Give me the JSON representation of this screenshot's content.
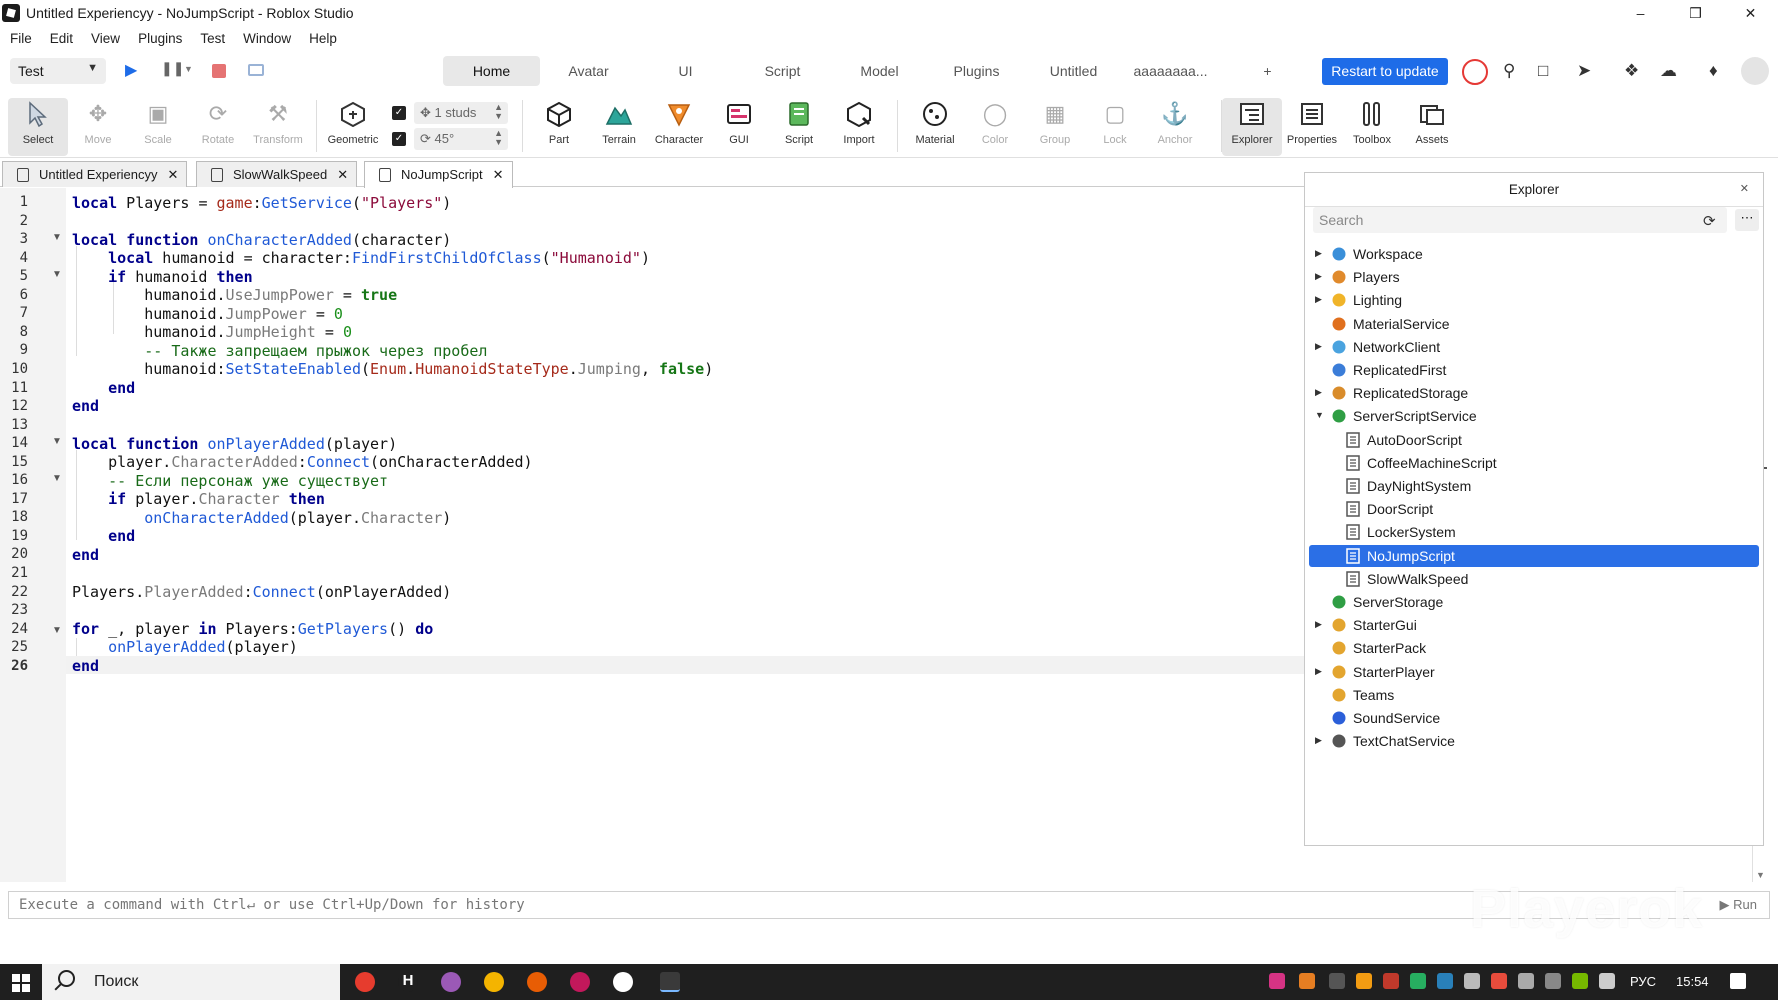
{
  "window": {
    "title": "Untitled Experiencyy - NoJumpScript - Roblox Studio",
    "controls": [
      "–",
      "❒",
      "✕"
    ]
  },
  "menu": [
    "File",
    "Edit",
    "View",
    "Plugins",
    "Test",
    "Window",
    "Help"
  ],
  "topnav": {
    "test_select": "Test",
    "tabs": [
      "Home",
      "Avatar",
      "UI",
      "Script",
      "Model",
      "Plugins",
      "Untitled",
      "aaaaaaaa...",
      "+"
    ],
    "active_tab": "Home",
    "restart_button": "Restart to update"
  },
  "ribbon": {
    "tools": [
      {
        "label": "Select",
        "icon": "cursor-icon"
      },
      {
        "label": "Move",
        "icon": "move-icon"
      },
      {
        "label": "Scale",
        "icon": "scale-icon"
      },
      {
        "label": "Rotate",
        "icon": "rotate-icon"
      },
      {
        "label": "Transform",
        "icon": "transform-icon"
      },
      {
        "label": "Geometric",
        "icon": "geometric-icon"
      },
      {
        "label": "Part",
        "icon": "part-icon"
      },
      {
        "label": "Terrain",
        "icon": "terrain-icon"
      },
      {
        "label": "Character",
        "icon": "character-icon"
      },
      {
        "label": "GUI",
        "icon": "gui-icon"
      },
      {
        "label": "Script",
        "icon": "script-icon"
      },
      {
        "label": "Import",
        "icon": "import-icon"
      },
      {
        "label": "Material",
        "icon": "material-icon"
      },
      {
        "label": "Color",
        "icon": "color-icon"
      },
      {
        "label": "Group",
        "icon": "group-icon"
      },
      {
        "label": "Lock",
        "icon": "lock-icon"
      },
      {
        "label": "Anchor",
        "icon": "anchor-icon"
      },
      {
        "label": "Explorer",
        "icon": "explorer-icon"
      },
      {
        "label": "Properties",
        "icon": "properties-icon"
      },
      {
        "label": "Toolbox",
        "icon": "toolbox-icon"
      },
      {
        "label": "Assets",
        "icon": "assets-icon"
      }
    ],
    "snap_move": "1 studs",
    "snap_rotate": "45°"
  },
  "doc_tabs": [
    {
      "label": "Untitled Experiencyy",
      "active": false
    },
    {
      "label": "SlowWalkSpeed",
      "active": false
    },
    {
      "label": "NoJumpScript",
      "active": true
    }
  ],
  "editor": {
    "line_numbers": [
      "1",
      "2",
      "3",
      "4",
      "5",
      "6",
      "7",
      "8",
      "9",
      "10",
      "11",
      "12",
      "13",
      "14",
      "15",
      "16",
      "17",
      "18",
      "19",
      "20",
      "21",
      "22",
      "23",
      "24",
      "25",
      "26"
    ],
    "current_line": "26",
    "comment_1": "-- Также запрещаем прыжок через пробел",
    "comment_2": "-- Если персонаж уже существует"
  },
  "command_bar": {
    "placeholder": "Execute a command with Ctrl↵ or use Ctrl+Up/Down for history",
    "run": "▶ Run"
  },
  "watermark": "Playerok",
  "explorer": {
    "title": "Explorer",
    "search_placeholder": "Search",
    "items": [
      {
        "label": "Workspace",
        "level": 0,
        "expandable": true,
        "expanded": false,
        "icon": "globe-icon",
        "color": "#3a8fd9"
      },
      {
        "label": "Players",
        "level": 0,
        "expandable": true,
        "expanded": false,
        "icon": "players-icon",
        "color": "#e08a2c"
      },
      {
        "label": "Lighting",
        "level": 0,
        "expandable": true,
        "expanded": false,
        "icon": "bulb-icon",
        "color": "#f0b429"
      },
      {
        "label": "MaterialService",
        "level": 0,
        "expandable": false,
        "expanded": false,
        "icon": "material-service-icon",
        "color": "#e0701e"
      },
      {
        "label": "NetworkClient",
        "level": 0,
        "expandable": true,
        "expanded": false,
        "icon": "network-icon",
        "color": "#4aa3df"
      },
      {
        "label": "ReplicatedFirst",
        "level": 0,
        "expandable": false,
        "expanded": false,
        "icon": "replicated-first-icon",
        "color": "#3b7dd8"
      },
      {
        "label": "ReplicatedStorage",
        "level": 0,
        "expandable": true,
        "expanded": false,
        "icon": "replicated-storage-icon",
        "color": "#d98c2b"
      },
      {
        "label": "ServerScriptService",
        "level": 0,
        "expandable": true,
        "expanded": true,
        "icon": "server-script-service-icon",
        "color": "#2f9e44"
      },
      {
        "label": "AutoDoorScript",
        "level": 1,
        "expandable": false,
        "expanded": false,
        "icon": "script-file-icon",
        "color": "#555555"
      },
      {
        "label": "CoffeeMachineScript",
        "level": 1,
        "expandable": false,
        "expanded": false,
        "icon": "script-file-icon",
        "color": "#555555"
      },
      {
        "label": "DayNightSystem",
        "level": 1,
        "expandable": false,
        "expanded": false,
        "icon": "script-file-icon",
        "color": "#555555"
      },
      {
        "label": "DoorScript",
        "level": 1,
        "expandable": false,
        "expanded": false,
        "icon": "script-file-icon",
        "color": "#555555"
      },
      {
        "label": "LockerSystem",
        "level": 1,
        "expandable": false,
        "expanded": false,
        "icon": "script-file-icon",
        "color": "#555555"
      },
      {
        "label": "NoJumpScript",
        "level": 1,
        "expandable": false,
        "expanded": false,
        "icon": "script-file-icon",
        "color": "#555555",
        "selected": true
      },
      {
        "label": "SlowWalkSpeed",
        "level": 1,
        "expandable": false,
        "expanded": false,
        "icon": "script-file-icon",
        "color": "#555555"
      },
      {
        "label": "ServerStorage",
        "level": 0,
        "expandable": false,
        "expanded": false,
        "icon": "server-storage-icon",
        "color": "#2f9e44"
      },
      {
        "label": "StarterGui",
        "level": 0,
        "expandable": true,
        "expanded": false,
        "icon": "folder-icon",
        "color": "#e3a52f"
      },
      {
        "label": "StarterPack",
        "level": 0,
        "expandable": false,
        "expanded": false,
        "icon": "folder-icon",
        "color": "#e3a52f"
      },
      {
        "label": "StarterPlayer",
        "level": 0,
        "expandable": true,
        "expanded": false,
        "icon": "folder-icon",
        "color": "#e3a52f"
      },
      {
        "label": "Teams",
        "level": 0,
        "expandable": false,
        "expanded": false,
        "icon": "teams-icon",
        "color": "#e3a52f"
      },
      {
        "label": "SoundService",
        "level": 0,
        "expandable": false,
        "expanded": false,
        "icon": "sound-icon",
        "color": "#2b5fd9"
      },
      {
        "label": "TextChatService",
        "level": 0,
        "expandable": true,
        "expanded": false,
        "icon": "chat-icon",
        "color": "#555555"
      }
    ]
  },
  "taskbar": {
    "search": "Поиск",
    "language": "РУС",
    "time": "15:54"
  },
  "colors": {
    "accent": "#1e6ce8",
    "selection": "#2b6fe6",
    "keyword": "#00008b",
    "function": "#1f59d6",
    "string": "#8b0a3a",
    "comment": "#186a18"
  }
}
